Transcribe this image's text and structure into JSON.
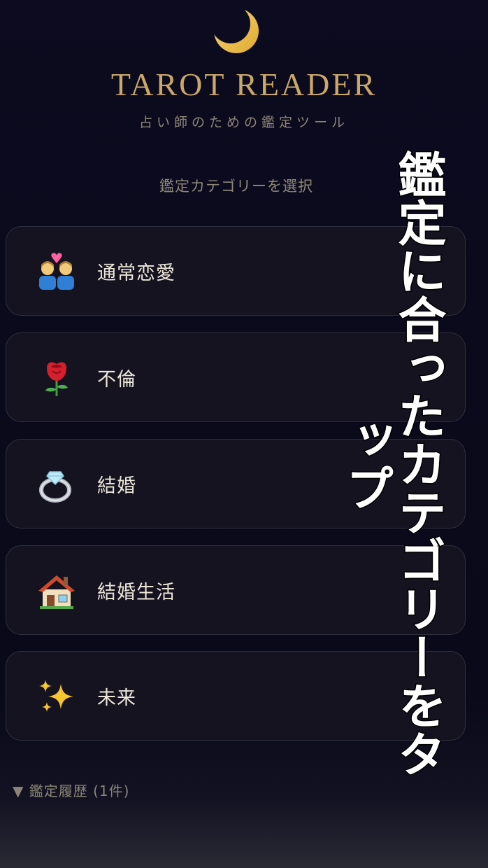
{
  "header": {
    "icon": "crescent-moon-icon",
    "title": "TAROT READER",
    "subtitle": "占い師のための鑑定ツール"
  },
  "categories_section": {
    "heading": "鑑定カテゴリーを選択",
    "items": [
      {
        "label": "通常恋愛",
        "icon": "couple-heart-icon"
      },
      {
        "label": "不倫",
        "icon": "rose-icon"
      },
      {
        "label": "結婚",
        "icon": "ring-icon"
      },
      {
        "label": "結婚生活",
        "icon": "house-icon"
      },
      {
        "label": "未来",
        "icon": "sparkles-icon"
      }
    ]
  },
  "history": {
    "label": "▼ 鑑定履歴 (1件)"
  },
  "overlay": {
    "text": "鑑定に合ったカテゴリーをタップ"
  },
  "colors": {
    "background": "#0b0a1c",
    "accent_gold": "#cba868",
    "card_border": "#2f2f3d",
    "muted_text": "#8e8878"
  }
}
